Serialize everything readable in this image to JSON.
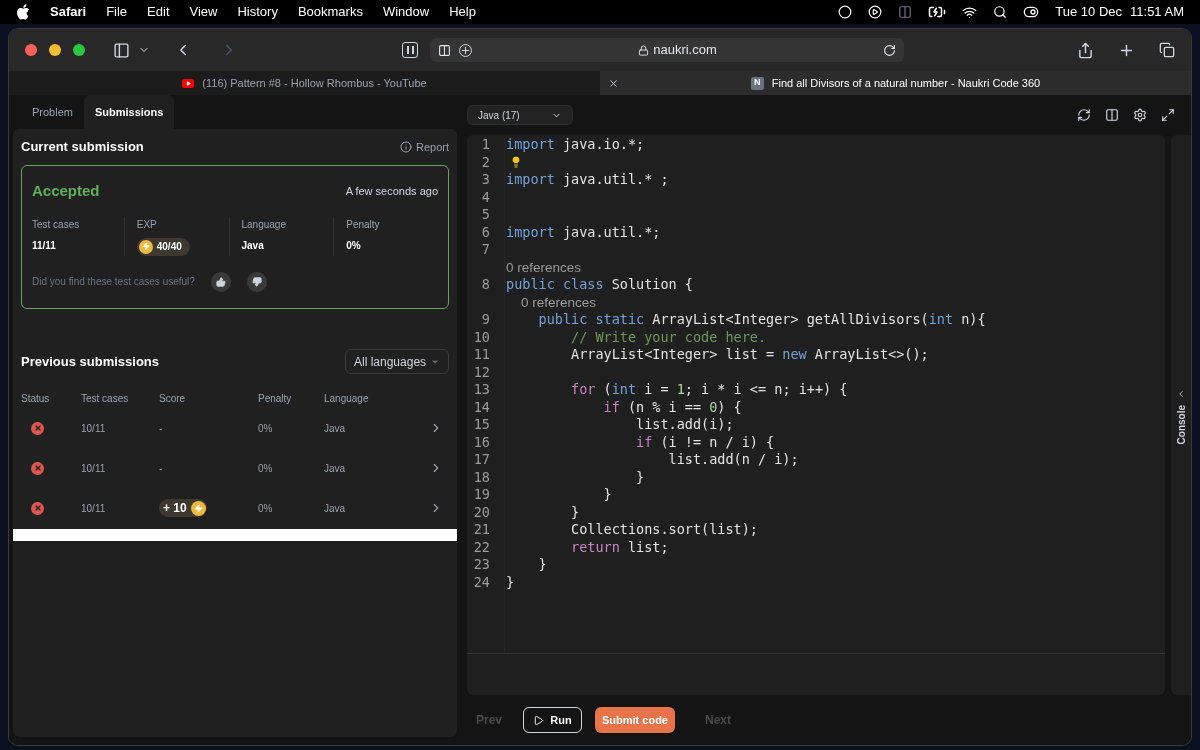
{
  "menu_bar": {
    "app": "Safari",
    "items": [
      "File",
      "Edit",
      "View",
      "History",
      "Bookmarks",
      "Window",
      "Help"
    ],
    "date": "Tue 10 Dec",
    "time": "11:51 AM"
  },
  "browser": {
    "address": "naukri.com",
    "tabs": [
      {
        "title": "(116) Pattern #8 - Hollow Rhombus - YouTube",
        "selected": false,
        "favicon": {
          "kind": "video"
        }
      },
      {
        "title": "Find all Divisors of a natural number - Naukri Code 360",
        "selected": true,
        "favicon": {
          "kind": "letter",
          "text": "N"
        }
      }
    ]
  },
  "panel_tabs": [
    {
      "label": "Problem",
      "selected": false
    },
    {
      "label": "Submissions",
      "selected": true
    }
  ],
  "current_submission": {
    "title": "Current submission",
    "report": "Report",
    "status": "Accepted",
    "time": "A few seconds ago",
    "stats": [
      {
        "label": "Test cases",
        "value": "11/11",
        "kind": "text"
      },
      {
        "label": "EXP",
        "value": "40/40",
        "kind": "exp"
      },
      {
        "label": "Language",
        "value": "Java",
        "kind": "text"
      },
      {
        "label": "Penalty",
        "value": "0%",
        "kind": "text"
      }
    ],
    "feedback": "Did you find these test cases useful?"
  },
  "previous_submissions": {
    "title": "Previous submissions",
    "filter": "All languages",
    "columns": [
      "Status",
      "Test cases",
      "Score",
      "Penalty",
      "Language"
    ],
    "rows": [
      {
        "failed": true,
        "test_cases": "10/11",
        "score": {
          "kind": "text",
          "text": "-"
        },
        "penalty": "0%",
        "language": "Java"
      },
      {
        "failed": true,
        "test_cases": "10/11",
        "score": {
          "kind": "text",
          "text": "-"
        },
        "penalty": "0%",
        "language": "Java"
      },
      {
        "failed": true,
        "test_cases": "10/11",
        "score": {
          "kind": "exp",
          "text": "+ 10"
        },
        "penalty": "0%",
        "language": "Java"
      }
    ]
  },
  "editor": {
    "language": "Java (17)",
    "lines": [
      {
        "kind": "code",
        "number": "1",
        "tokens": [
          {
            "kind": "kw",
            "text": "import"
          },
          {
            "kind": "plain",
            "text": " java.io.*;"
          }
        ]
      },
      {
        "kind": "code",
        "number": "2",
        "hint": true
      },
      {
        "kind": "code",
        "number": "3",
        "tokens": [
          {
            "kind": "kw",
            "text": "import"
          },
          {
            "kind": "plain",
            "text": " java.util.* ;"
          }
        ]
      },
      {
        "kind": "code",
        "number": "4"
      },
      {
        "kind": "code",
        "number": "5"
      },
      {
        "kind": "code",
        "number": "6",
        "tokens": [
          {
            "kind": "kw",
            "text": "import"
          },
          {
            "kind": "plain",
            "text": " java.util.*;"
          }
        ]
      },
      {
        "kind": "code",
        "number": "7"
      },
      {
        "kind": "lens",
        "text": "0 references"
      },
      {
        "kind": "code",
        "number": "8",
        "tokens": [
          {
            "kind": "kw",
            "text": "public"
          },
          {
            "kind": "kw",
            "text": " class"
          },
          {
            "kind": "plain",
            "text": " Solution {"
          }
        ]
      },
      {
        "kind": "lens",
        "text": "    0 references"
      },
      {
        "kind": "code",
        "number": "9",
        "tokens": [
          {
            "kind": "kw",
            "text": "    public"
          },
          {
            "kind": "kw",
            "text": " static"
          },
          {
            "kind": "plain",
            "text": " ArrayList<Integer> getAllDivisors("
          },
          {
            "kind": "kw",
            "text": "int"
          },
          {
            "kind": "plain",
            "text": " n){"
          }
        ]
      },
      {
        "kind": "code",
        "number": "10",
        "tokens": [
          {
            "kind": "comment",
            "text": "        // Write your code here."
          }
        ]
      },
      {
        "kind": "code",
        "number": "11",
        "tokens": [
          {
            "kind": "plain",
            "text": "        ArrayList<Integer> list = "
          },
          {
            "kind": "kw",
            "text": "new"
          },
          {
            "kind": "plain",
            "text": " ArrayList<>();"
          }
        ]
      },
      {
        "kind": "code",
        "number": "12"
      },
      {
        "kind": "code",
        "number": "13",
        "tokens": [
          {
            "kind": "ctrl",
            "text": "        for"
          },
          {
            "kind": "plain",
            "text": " ("
          },
          {
            "kind": "kw",
            "text": "int"
          },
          {
            "kind": "plain",
            "text": " i = "
          },
          {
            "kind": "num",
            "text": "1"
          },
          {
            "kind": "plain",
            "text": "; i * i <= n; i++) {"
          }
        ]
      },
      {
        "kind": "code",
        "number": "14",
        "tokens": [
          {
            "kind": "ctrl",
            "text": "            if"
          },
          {
            "kind": "plain",
            "text": " (n % i == "
          },
          {
            "kind": "num",
            "text": "0"
          },
          {
            "kind": "plain",
            "text": ") {"
          }
        ]
      },
      {
        "kind": "code",
        "number": "15",
        "tokens": [
          {
            "kind": "plain",
            "text": "                list.add(i);"
          }
        ]
      },
      {
        "kind": "code",
        "number": "16",
        "tokens": [
          {
            "kind": "ctrl",
            "text": "                if"
          },
          {
            "kind": "plain",
            "text": " (i != n / i) {"
          }
        ]
      },
      {
        "kind": "code",
        "number": "17",
        "tokens": [
          {
            "kind": "plain",
            "text": "                    list.add(n / i);"
          }
        ]
      },
      {
        "kind": "code",
        "number": "18",
        "tokens": [
          {
            "kind": "plain",
            "text": "                }"
          }
        ]
      },
      {
        "kind": "code",
        "number": "19",
        "tokens": [
          {
            "kind": "plain",
            "text": "            }"
          }
        ]
      },
      {
        "kind": "code",
        "number": "20",
        "tokens": [
          {
            "kind": "plain",
            "text": "        }"
          }
        ]
      },
      {
        "kind": "code",
        "number": "21",
        "tokens": [
          {
            "kind": "plain",
            "text": "        Collections.sort(list);"
          }
        ]
      },
      {
        "kind": "code",
        "number": "22",
        "tokens": [
          {
            "kind": "ctrl",
            "text": "        return"
          },
          {
            "kind": "plain",
            "text": " list;"
          }
        ]
      },
      {
        "kind": "code",
        "number": "23",
        "tokens": [
          {
            "kind": "plain",
            "text": "    }"
          }
        ]
      },
      {
        "kind": "code",
        "number": "24",
        "tokens": [
          {
            "kind": "plain",
            "text": "}"
          }
        ]
      }
    ],
    "console": "Console"
  },
  "footer": {
    "prev": "Prev",
    "run": "Run",
    "submit": "Submit code",
    "next": "Next"
  }
}
